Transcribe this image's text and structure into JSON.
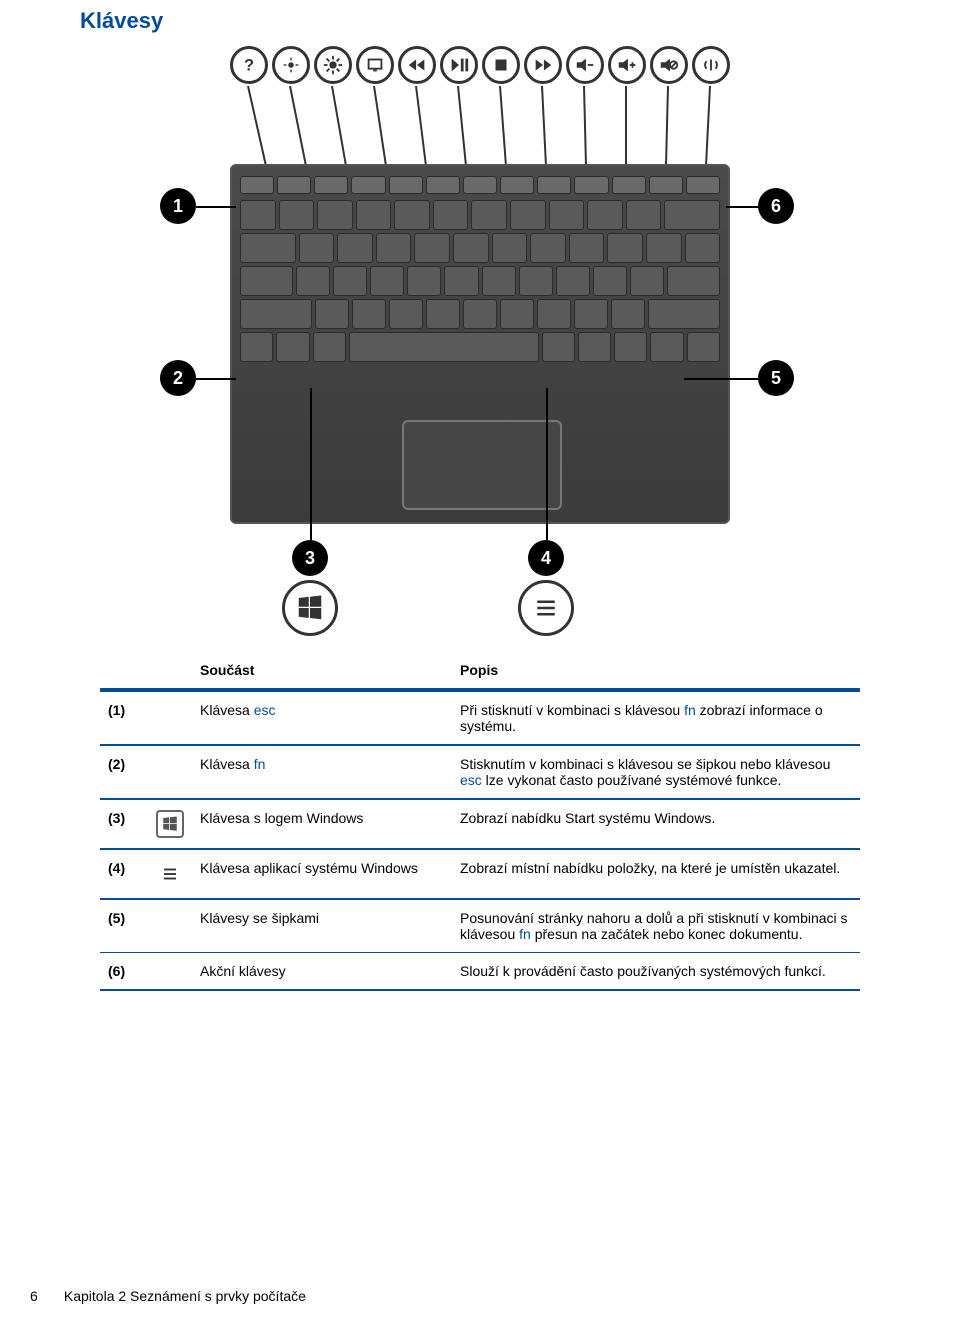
{
  "section_title": "Klávesy",
  "icons_row": [
    "help-icon",
    "brightness-down-icon",
    "brightness-up-icon",
    "display-switch-icon",
    "prev-track-icon",
    "play-pause-icon",
    "stop-icon",
    "next-track-icon",
    "volume-down-icon",
    "volume-up-icon",
    "mute-icon",
    "wireless-icon"
  ],
  "callouts": {
    "c1": "1",
    "c2": "2",
    "c3": "3",
    "c4": "4",
    "c5": "5",
    "c6": "6"
  },
  "table": {
    "head": {
      "component": "Součást",
      "desc": "Popis"
    },
    "rows": [
      {
        "num": "(1)",
        "name_pre": "Klávesa ",
        "name_em": "esc",
        "name_post": "",
        "desc_pre": "Při stisknutí v kombinaci s klávesou ",
        "desc_em": "fn",
        "desc_post": " zobrazí informace o systému."
      },
      {
        "num": "(2)",
        "name_pre": "Klávesa ",
        "name_em": "fn",
        "name_post": "",
        "desc_pre": "Stisknutím v kombinaci s klávesou se šipkou nebo klávesou ",
        "desc_em": "esc",
        "desc_post": " lze vykonat často používané systémové funkce."
      },
      {
        "num": "(3)",
        "icon": "windows-logo-icon",
        "name_pre": "Klávesa s logem Windows",
        "name_em": "",
        "name_post": "",
        "desc_pre": "Zobrazí nabídku Start systému Windows.",
        "desc_em": "",
        "desc_post": ""
      },
      {
        "num": "(4)",
        "icon": "menu-icon",
        "name_pre": "Klávesa aplikací systému Windows",
        "name_em": "",
        "name_post": "",
        "desc_pre": "Zobrazí místní nabídku položky, na které je umístěn ukazatel.",
        "desc_em": "",
        "desc_post": ""
      },
      {
        "num": "(5)",
        "name_pre": "Klávesy se šipkami",
        "name_em": "",
        "name_post": "",
        "desc_pre": "Posunování stránky nahoru a dolů a při stisknutí v kombinaci s klávesou ",
        "desc_em": "fn",
        "desc_post": " přesun na začátek nebo konec dokumentu."
      },
      {
        "num": "(6)",
        "name_pre": "Akční klávesy",
        "name_em": "",
        "name_post": "",
        "desc_pre": "Slouží k provádění často používaných systémových funkcí.",
        "desc_em": "",
        "desc_post": ""
      }
    ]
  },
  "footer": {
    "page": "6",
    "chapter": "Kapitola 2   Seznámení s prvky počítače"
  }
}
